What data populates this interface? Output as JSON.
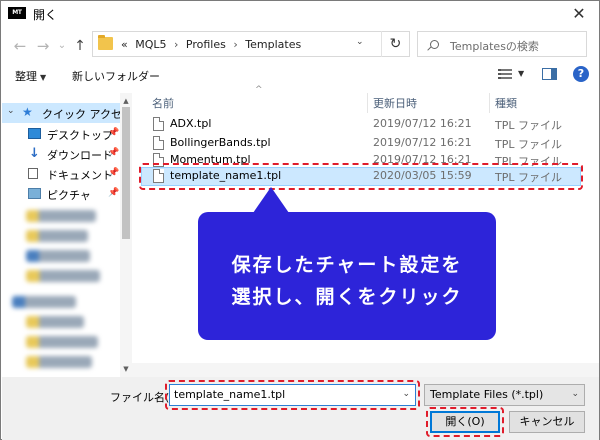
{
  "window": {
    "app_icon_text": "MT",
    "title": "開く",
    "close_glyph": "✕"
  },
  "nav": {
    "back": "←",
    "forward": "→",
    "dropdown": "⌄",
    "up": "↑"
  },
  "address": {
    "prefix": "«",
    "crumbs": [
      "MQL5",
      "Profiles",
      "Templates"
    ],
    "separator": "›",
    "dropdown": "⌄",
    "refresh": "↻"
  },
  "search": {
    "placeholder": "Templatesの検索"
  },
  "toolbar": {
    "organize_label": "整理",
    "organize_caret": "▼",
    "new_folder_label": "新しいフォルダー",
    "view_caret": "▼",
    "help_glyph": "?"
  },
  "sidebar": {
    "quick_access": "クイック アクセス",
    "items": [
      {
        "label": "デスクトップ",
        "icon": "desktop-icon",
        "pin": "📌"
      },
      {
        "label": "ダウンロード",
        "icon": "download-icon",
        "pin": "📌"
      },
      {
        "label": "ドキュメント",
        "icon": "documents-icon",
        "pin": "📌"
      },
      {
        "label": "ピクチャ",
        "icon": "pictures-icon",
        "pin": "📌"
      }
    ]
  },
  "columns": {
    "name": "名前",
    "date": "更新日時",
    "type": "種類",
    "sort_glyph": "^"
  },
  "files": [
    {
      "name": "ADX.tpl",
      "date": "2019/07/12 16:21",
      "type": "TPL ファイル"
    },
    {
      "name": "BollingerBands.tpl",
      "date": "2019/07/12 16:21",
      "type": "TPL ファイル"
    },
    {
      "name": "Momentum.tpl",
      "date": "2019/07/12 16:21",
      "type": "TPL ファイル"
    },
    {
      "name": "template_name1.tpl",
      "date": "2020/03/05 15:59",
      "type": "TPL ファイル"
    }
  ],
  "callout": {
    "line1": "保存したチャート設定を",
    "line2": "選択し、開くをクリック"
  },
  "footer": {
    "filename_label": "ファイル名(N):",
    "filename_value": "template_name1.tpl",
    "filter_value": "Template Files (*.tpl)",
    "dropdown_glyph": "⌄",
    "open_label": "開く(O)",
    "cancel_label": "キャンセル"
  },
  "colors": {
    "accent": "#0078d7",
    "selection": "#cce8ff",
    "callout": "#2d24d9",
    "highlight": "#e01c2b"
  }
}
